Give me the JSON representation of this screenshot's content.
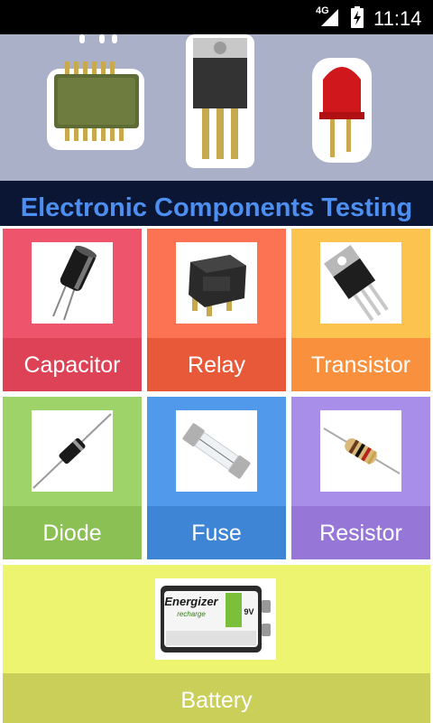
{
  "status_bar": {
    "network": "4G",
    "time": "11:14"
  },
  "app": {
    "title": "Electronic Components Testing"
  },
  "tiles": [
    {
      "label": "Capacitor",
      "icon": "capacitor-icon"
    },
    {
      "label": "Relay",
      "icon": "relay-icon"
    },
    {
      "label": "Transistor",
      "icon": "transistor-icon"
    },
    {
      "label": "Diode",
      "icon": "diode-icon"
    },
    {
      "label": "Fuse",
      "icon": "fuse-icon"
    },
    {
      "label": "Resistor",
      "icon": "resistor-icon"
    },
    {
      "label": "Battery",
      "icon": "battery-icon"
    }
  ],
  "battery_image_text": {
    "brand": "Energizer",
    "sub": "recharge",
    "voltage": "9V"
  },
  "colors": {
    "title_text": "#4d8ff0",
    "capacitor": "#ee546b",
    "relay": "#fb7353",
    "transistor": "#fcc44e",
    "diode": "#9ed36a",
    "fuse": "#5199ea",
    "resistor": "#a88ee9",
    "battery": "#ecf470"
  }
}
